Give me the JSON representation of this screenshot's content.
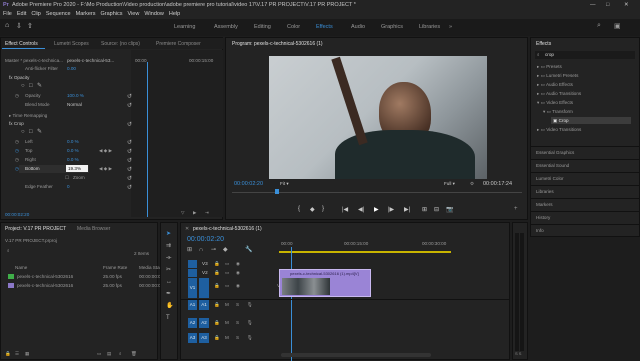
{
  "app": {
    "title": "Adobe Premiere Pro 2020 - F:\\Mo Production\\Video production\\adobe premiere pro tutorial\\video 17\\V.17 PR PROJECT\\V.17 PR PROJECT *",
    "window_controls": [
      "—",
      "□",
      "✕"
    ]
  },
  "menu": [
    "File",
    "Edit",
    "Clip",
    "Sequence",
    "Markers",
    "Graphics",
    "View",
    "Window",
    "Help"
  ],
  "workspaces": [
    "Learning",
    "Assembly",
    "Editing",
    "Color",
    "Effects",
    "Audio",
    "Graphics",
    "Libraries"
  ],
  "effect_controls": {
    "tabs": [
      "Effect Controls",
      "Lumetri Scopes",
      "Source: (no clips)",
      "Premiere Composer"
    ],
    "master": "Master * pexels-c-technica...",
    "clip": "pexels-c-technical-53...",
    "time_start": "00:00",
    "time_end": "00:00:15:00",
    "anti_flicker": {
      "label": "Anti-flicker Filter",
      "value": "0.00"
    },
    "opacity": {
      "section": "Opacity",
      "opacity_label": "Opacity",
      "opacity_value": "100.0 %",
      "blend_label": "Blend Mode",
      "blend_value": "Normal"
    },
    "time_remap": "Time Remapping",
    "crop": {
      "section": "Crop",
      "left_label": "Left",
      "left_value": "0.0 %",
      "top_label": "Top",
      "top_value": "0.0 %",
      "right_label": "Right",
      "right_value": "0.0 %",
      "bottom_label": "Bottom",
      "bottom_value": "19.3%",
      "zoom_label": "Zoom",
      "edge_label": "Edge Feather",
      "edge_value": "0"
    },
    "timecode": "00:00:02:20"
  },
  "program": {
    "title": "Program: pexels-c-technical-5302616 (1)",
    "timecode": "00:00:02:20",
    "fit": "Fit",
    "quality": "Full",
    "duration": "00:00:17:24",
    "transport": [
      "{",
      "◆",
      "}",
      "|◀",
      "◀|",
      "▶",
      "|▶",
      "▶|",
      "⊞",
      "⊟",
      "📷",
      "+"
    ]
  },
  "effects": {
    "title": "Effects",
    "search": "crop",
    "tree": [
      "Presets",
      "Lumetri Presets",
      "Audio Effects",
      "Audio Transitions",
      "Video Effects",
      "Transform",
      "Crop",
      "Video Transitions"
    ],
    "panels": [
      "Essential Graphics",
      "Essential Sound",
      "Lumetri Color",
      "Libraries",
      "Markers",
      "History",
      "Info"
    ]
  },
  "project": {
    "tabs": [
      "Project: V.17 PR PROJECT",
      "Media Browser"
    ],
    "file": "V.17 PR PROJECT.prproj",
    "items_count": "2 Items",
    "columns": [
      "Name",
      "Frame Rate",
      "Media Start"
    ],
    "rows": [
      {
        "name": "pexels-c-technical-5302616",
        "fps": "25.00 fps",
        "start": "00:00:00:00",
        "color": "#3fae49"
      },
      {
        "name": "pexels-c-technical-5302616",
        "fps": "25.00 fps",
        "start": "00:00:00:00",
        "color": "#8b78c8"
      }
    ]
  },
  "timeline": {
    "title": "pexels-c-technical-5302616 (1)",
    "timecode": "00:00:02:20",
    "ruler": [
      "00:00",
      "00:00:15:00",
      "00:00:30:00"
    ],
    "video_tracks": [
      "V3",
      "V2",
      "V1"
    ],
    "audio_tracks": [
      "A1",
      "A2",
      "A3"
    ],
    "v1_name": "Video 1",
    "clip_label": "pexels-c-technical-5302616 (1).mp4[V]",
    "audio_buttons": [
      "M",
      "S"
    ]
  },
  "meters": [
    "0",
    "-12",
    "-24",
    "-36",
    "-48",
    "dB"
  ],
  "colors": {
    "accent": "#3a8fd8",
    "clip": "#9a84d6",
    "audio_track": "#1e5fa0",
    "playhead": "#3a8fd8"
  }
}
